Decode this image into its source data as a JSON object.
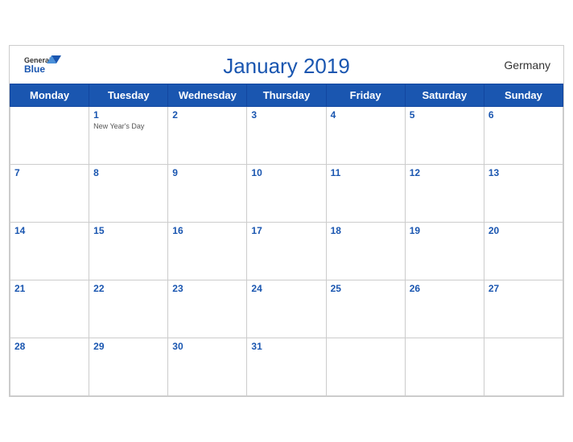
{
  "header": {
    "title": "January 2019",
    "country": "Germany",
    "logo_general": "General",
    "logo_blue": "Blue"
  },
  "weekdays": [
    "Monday",
    "Tuesday",
    "Wednesday",
    "Thursday",
    "Friday",
    "Saturday",
    "Sunday"
  ],
  "weeks": [
    [
      {
        "day": "",
        "empty": true
      },
      {
        "day": "1",
        "holiday": "New Year's Day"
      },
      {
        "day": "2"
      },
      {
        "day": "3"
      },
      {
        "day": "4"
      },
      {
        "day": "5"
      },
      {
        "day": "6"
      }
    ],
    [
      {
        "day": "7"
      },
      {
        "day": "8"
      },
      {
        "day": "9"
      },
      {
        "day": "10"
      },
      {
        "day": "11"
      },
      {
        "day": "12"
      },
      {
        "day": "13"
      }
    ],
    [
      {
        "day": "14"
      },
      {
        "day": "15"
      },
      {
        "day": "16"
      },
      {
        "day": "17"
      },
      {
        "day": "18"
      },
      {
        "day": "19"
      },
      {
        "day": "20"
      }
    ],
    [
      {
        "day": "21"
      },
      {
        "day": "22"
      },
      {
        "day": "23"
      },
      {
        "day": "24"
      },
      {
        "day": "25"
      },
      {
        "day": "26"
      },
      {
        "day": "27"
      }
    ],
    [
      {
        "day": "28"
      },
      {
        "day": "29"
      },
      {
        "day": "30"
      },
      {
        "day": "31"
      },
      {
        "day": ""
      },
      {
        "day": ""
      },
      {
        "day": ""
      }
    ]
  ],
  "colors": {
    "header_bg": "#1a56b0",
    "accent": "#1a56b0"
  }
}
